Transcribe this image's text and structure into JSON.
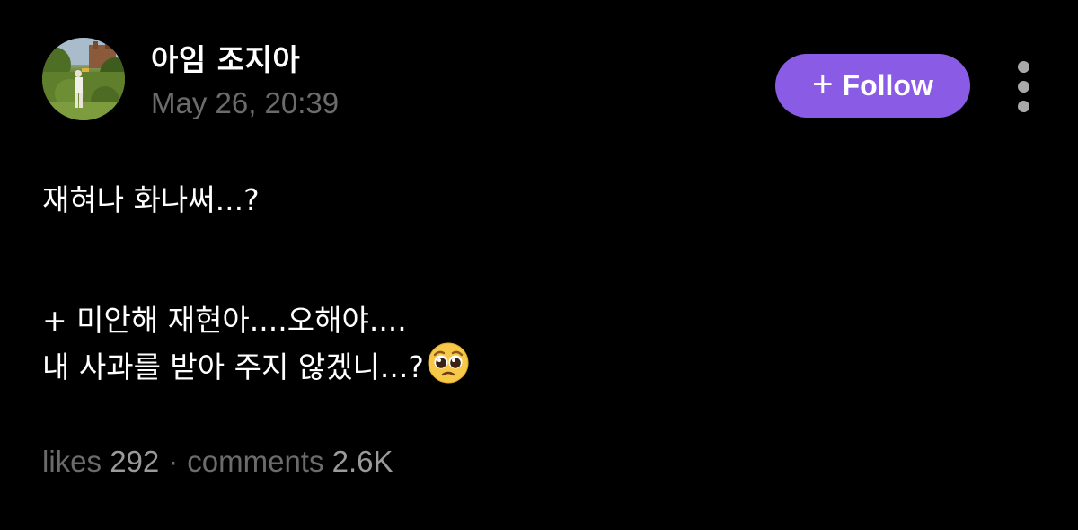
{
  "post": {
    "author": "아임 조지아",
    "timestamp": "May 26, 20:39",
    "follow_label": "Follow",
    "follow_plus": "+",
    "body_lines": [
      "재혀나 화나써...?",
      "+ 미안해 재현아....오해야....",
      "내 사과를 받아 주지 않겠니...?"
    ],
    "emoji": "pleading-face-icon"
  },
  "stats": {
    "likes_label": "likes",
    "likes_count": "292",
    "separator": "·",
    "comments_label": "comments",
    "comments_count": "2.6K"
  },
  "colors": {
    "background": "#000000",
    "follow_button": "#8a5ce6",
    "muted_text": "#6b6b6b"
  }
}
